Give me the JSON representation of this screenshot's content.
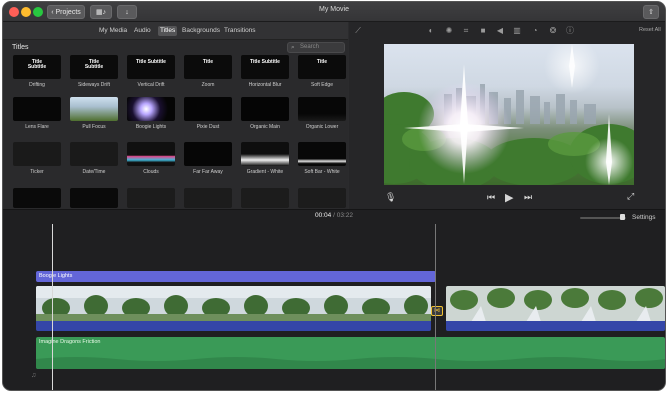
{
  "window": {
    "title": "My Movie",
    "projects_label": "Projects"
  },
  "browser": {
    "tabs": [
      "My Media",
      "Audio",
      "Titles",
      "Backgrounds",
      "Transitions"
    ],
    "active_tab": "Titles",
    "section_title": "Titles",
    "search_placeholder": "Search",
    "tiles": [
      {
        "label": "Drifting",
        "text": "Title\nSubtitle"
      },
      {
        "label": "Sideways Drift",
        "text": "Title\nSubtitle"
      },
      {
        "label": "Vertical Drift",
        "text": "Title Subtitle"
      },
      {
        "label": "Zoom",
        "text": "Title"
      },
      {
        "label": "Horizontal Blur",
        "text": "Title Subtitle"
      },
      {
        "label": "Soft Edge",
        "text": "Title"
      },
      {
        "label": "Lens Flare",
        "text": ""
      },
      {
        "label": "Pull Focus",
        "text": ""
      },
      {
        "label": "Boogie Lights",
        "text": ""
      },
      {
        "label": "Pixie Dust",
        "text": ""
      },
      {
        "label": "Organic Main",
        "text": ""
      },
      {
        "label": "Organic Lower",
        "text": ""
      },
      {
        "label": "Ticker",
        "text": ""
      },
      {
        "label": "Date/Time",
        "text": ""
      },
      {
        "label": "Clouds",
        "text": ""
      },
      {
        "label": "Far Far Away",
        "text": ""
      },
      {
        "label": "Gradient - White",
        "text": ""
      },
      {
        "label": "Soft Bar - White",
        "text": ""
      }
    ]
  },
  "viewer": {
    "reset_all": "Reset All"
  },
  "timeline": {
    "current_time": "00:04",
    "separator": "/",
    "total_time": "03:22",
    "settings_label": "Settings",
    "title_clip": "Boogie Lights",
    "music_clip": "Imagine Dragons Friction"
  },
  "colors": {
    "title_clip": "#6366d8",
    "music_clip": "#3a9a57",
    "audio_band": "#3446a8"
  }
}
